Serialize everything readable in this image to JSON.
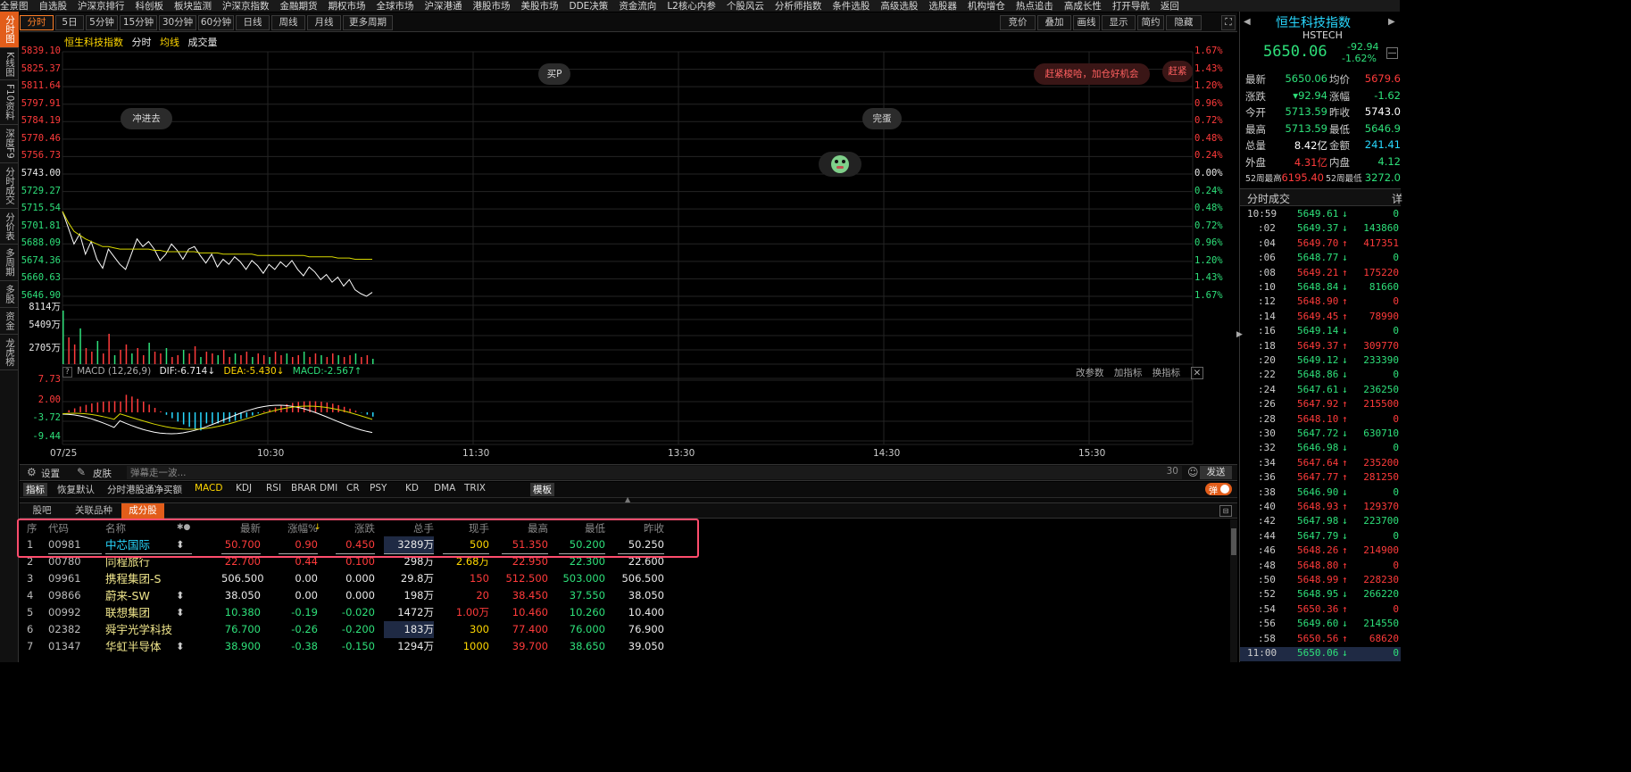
{
  "top_menu": [
    "全景图",
    "自选股",
    "沪深京排行",
    "科创板",
    "板块监测",
    "沪深京指数",
    "金融期货",
    "期权市场",
    "全球市场",
    "沪深港通",
    "港股市场",
    "美股市场",
    "DDE决策",
    "资金流向",
    "L2核心内参",
    "个股风云",
    "分析师指数",
    "条件选股",
    "高级选股",
    "选股器",
    "机构增仓",
    "热点追击",
    "高成长性",
    "打开导航",
    "返回"
  ],
  "left_tabs": [
    "分时图",
    "K线图",
    "F10资料",
    "深度F9",
    "分时成交",
    "分价表",
    "多周期",
    "多股",
    "资金",
    "龙虎榜"
  ],
  "period_buttons": [
    "分时",
    "5日",
    "5分钟",
    "15分钟",
    "30分钟",
    "60分钟",
    "日线",
    "周线",
    "月线",
    "更多周期"
  ],
  "right_buttons": [
    "竞价",
    "叠加",
    "画线",
    "显示",
    "简约",
    "隐藏"
  ],
  "chart_header": {
    "name": "恒生科技指数",
    "mode": "分时",
    "avg": "均线",
    "vol": "成交量"
  },
  "price_axis_left": [
    "5839.10",
    "5825.37",
    "5811.64",
    "5797.91",
    "5784.19",
    "5770.46",
    "5756.73",
    "5743.00",
    "5729.27",
    "5715.54",
    "5701.81",
    "5688.09",
    "5674.36",
    "5660.63",
    "5646.90"
  ],
  "pct_axis_right": [
    "1.67%",
    "1.43%",
    "1.20%",
    "0.96%",
    "0.72%",
    "0.48%",
    "0.24%",
    "0.00%",
    "0.24%",
    "0.48%",
    "0.72%",
    "0.96%",
    "1.20%",
    "1.43%",
    "1.67%"
  ],
  "volume_axis": [
    "8114万",
    "5409万",
    "2705万"
  ],
  "macd_header": {
    "title": "MACD (12,26,9)",
    "dif": "DIF:-6.714",
    "dea": "DEA:-5.430",
    "macd": "MACD:-2.567",
    "actions": [
      "改参数",
      "加指标",
      "换指标"
    ]
  },
  "macd_axis": [
    "7.73",
    "2.00",
    "-3.72",
    "-9.44"
  ],
  "time_axis": [
    "07/25",
    "10:30",
    "11:30",
    "13:30",
    "14:30",
    "15:30"
  ],
  "bubbles": {
    "buy": "买P",
    "chong": "冲进去",
    "wan": "完蛋",
    "promo": "赶紧梭哈，加仓好机会",
    "promo2": "赶紧"
  },
  "danmu": {
    "settings": "设置",
    "skin": "皮肤",
    "placeholder": "弹幕走一波...",
    "count": "30",
    "send": "发送"
  },
  "indicator_tabs": [
    "指标",
    "恢复默认",
    "分时港股通净买额",
    "MACD",
    "KDJ",
    "RSI",
    "BRAR",
    "DMI",
    "CR",
    "PSY",
    "KD",
    "DMA",
    "TRIX",
    "模板"
  ],
  "danmu_toggle": "弹",
  "sub_tabs": [
    "股吧",
    "关联品种",
    "成分股"
  ],
  "table_headers": [
    "序",
    "代码",
    "名称",
    "",
    "最新",
    "涨幅%",
    "涨跌",
    "总手",
    "现手",
    "最高",
    "最低",
    "昨收"
  ],
  "table_rows": [
    {
      "seq": "1",
      "code": "00981",
      "name": "中芯国际",
      "mark": "⬍",
      "last": "50.700",
      "pct": "0.90",
      "chg": "0.450",
      "vol": "3289万",
      "cur": "500",
      "high": "51.350",
      "low": "50.200",
      "prev": "50.250",
      "dir": "up"
    },
    {
      "seq": "2",
      "code": "00780",
      "name": "同程旅行",
      "mark": "",
      "last": "22.700",
      "pct": "0.44",
      "chg": "0.100",
      "vol": "298万",
      "cur": "2.68万",
      "high": "22.950",
      "low": "22.300",
      "prev": "22.600",
      "dir": "up"
    },
    {
      "seq": "3",
      "code": "09961",
      "name": "携程集团-S",
      "mark": "",
      "last": "506.500",
      "pct": "0.00",
      "chg": "0.000",
      "vol": "29.8万",
      "cur": "150",
      "high": "512.500",
      "low": "503.000",
      "prev": "506.500",
      "dir": "flat"
    },
    {
      "seq": "4",
      "code": "09866",
      "name": "蔚来-SW",
      "mark": "⬍",
      "last": "38.050",
      "pct": "0.00",
      "chg": "0.000",
      "vol": "198万",
      "cur": "20",
      "high": "38.450",
      "low": "37.550",
      "prev": "38.050",
      "dir": "flat"
    },
    {
      "seq": "5",
      "code": "00992",
      "name": "联想集团",
      "mark": "⬍",
      "last": "10.380",
      "pct": "-0.19",
      "chg": "-0.020",
      "vol": "1472万",
      "cur": "1.00万",
      "high": "10.460",
      "low": "10.260",
      "prev": "10.400",
      "dir": "down"
    },
    {
      "seq": "6",
      "code": "02382",
      "name": "舜宇光学科技",
      "mark": "",
      "last": "76.700",
      "pct": "-0.26",
      "chg": "-0.200",
      "vol": "183万",
      "cur": "300",
      "high": "77.400",
      "low": "76.000",
      "prev": "76.900",
      "dir": "down"
    },
    {
      "seq": "7",
      "code": "01347",
      "name": "华虹半导体",
      "mark": "⬍",
      "last": "38.900",
      "pct": "-0.38",
      "chg": "-0.150",
      "vol": "1294万",
      "cur": "1000",
      "high": "39.700",
      "low": "38.650",
      "prev": "39.050",
      "dir": "down"
    }
  ],
  "quote": {
    "name": "恒生科技指数",
    "code": "HSTECH",
    "price": "5650.06",
    "chg": "-92.94",
    "pct": "-1.62%",
    "rows": [
      [
        "最新",
        "5650.06",
        "均价",
        "5679.6"
      ],
      [
        "涨跌",
        "▾92.94",
        "涨幅",
        "-1.62"
      ],
      [
        "今开",
        "5713.59",
        "昨收",
        "5743.0"
      ],
      [
        "最高",
        "5713.59",
        "最低",
        "5646.9"
      ],
      [
        "总量",
        "8.42亿",
        "金额",
        "241.41"
      ],
      [
        "外盘",
        "4.31亿",
        "内盘",
        "4.12"
      ],
      [
        "52周最高",
        "6195.40",
        "52周最低",
        "3272.0"
      ]
    ]
  },
  "ticks_title": "分时成交",
  "ticks": [
    {
      "t": "10:59",
      "p": "5649.61",
      "a": "↓",
      "v": "0"
    },
    {
      "t": ":02",
      "p": "5649.37",
      "a": "↓",
      "v": "143860"
    },
    {
      "t": ":04",
      "p": "5649.70",
      "a": "↑",
      "v": "417351"
    },
    {
      "t": ":06",
      "p": "5648.77",
      "a": "↓",
      "v": "0"
    },
    {
      "t": ":08",
      "p": "5649.21",
      "a": "↑",
      "v": "175220"
    },
    {
      "t": ":10",
      "p": "5648.84",
      "a": "↓",
      "v": "81660"
    },
    {
      "t": ":12",
      "p": "5648.90",
      "a": "↑",
      "v": "0"
    },
    {
      "t": ":14",
      "p": "5649.45",
      "a": "↑",
      "v": "78990"
    },
    {
      "t": ":16",
      "p": "5649.14",
      "a": "↓",
      "v": "0"
    },
    {
      "t": ":18",
      "p": "5649.37",
      "a": "↑",
      "v": "309770"
    },
    {
      "t": ":20",
      "p": "5649.12",
      "a": "↓",
      "v": "233390"
    },
    {
      "t": ":22",
      "p": "5648.86",
      "a": "↓",
      "v": "0"
    },
    {
      "t": ":24",
      "p": "5647.61",
      "a": "↓",
      "v": "236250"
    },
    {
      "t": ":26",
      "p": "5647.92",
      "a": "↑",
      "v": "215500"
    },
    {
      "t": ":28",
      "p": "5648.10",
      "a": "↑",
      "v": "0"
    },
    {
      "t": ":30",
      "p": "5647.72",
      "a": "↓",
      "v": "630710"
    },
    {
      "t": ":32",
      "p": "5646.98",
      "a": "↓",
      "v": "0"
    },
    {
      "t": ":34",
      "p": "5647.64",
      "a": "↑",
      "v": "235200"
    },
    {
      "t": ":36",
      "p": "5647.77",
      "a": "↑",
      "v": "281250"
    },
    {
      "t": ":38",
      "p": "5646.90",
      "a": "↓",
      "v": "0"
    },
    {
      "t": ":40",
      "p": "5648.93",
      "a": "↑",
      "v": "129370"
    },
    {
      "t": ":42",
      "p": "5647.98",
      "a": "↓",
      "v": "223700"
    },
    {
      "t": ":44",
      "p": "5647.79",
      "a": "↓",
      "v": "0"
    },
    {
      "t": ":46",
      "p": "5648.26",
      "a": "↑",
      "v": "214900"
    },
    {
      "t": ":48",
      "p": "5648.80",
      "a": "↑",
      "v": "0"
    },
    {
      "t": ":50",
      "p": "5648.99",
      "a": "↑",
      "v": "228230"
    },
    {
      "t": ":52",
      "p": "5648.95",
      "a": "↓",
      "v": "266220"
    },
    {
      "t": ":54",
      "p": "5650.36",
      "a": "↑",
      "v": "0"
    },
    {
      "t": ":56",
      "p": "5649.60",
      "a": "↓",
      "v": "214550"
    },
    {
      "t": ":58",
      "p": "5650.56",
      "a": "↑",
      "v": "68620"
    },
    {
      "t": "11:00",
      "p": "5650.06",
      "a": "↓",
      "v": "0"
    }
  ],
  "colors": {
    "accent": "#e25d1a",
    "up": "#ff3b3b",
    "down": "#2ee07a",
    "price_line": "#ffffff",
    "avg_line": "#d8d800",
    "highlight_box": "#ff4d6d"
  }
}
